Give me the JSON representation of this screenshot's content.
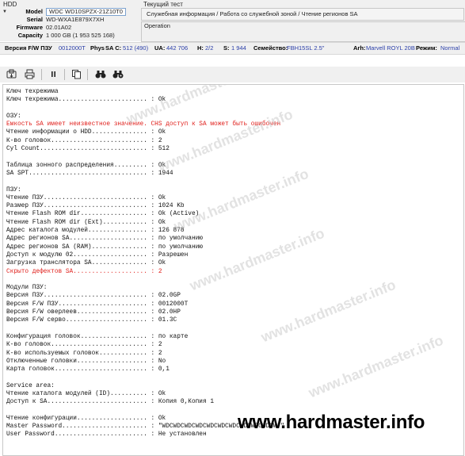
{
  "hdd": {
    "group_title": "HDD",
    "rows": [
      {
        "label": "Model",
        "value": "WDC WD10SPZX-21Z10T0"
      },
      {
        "label": "Serial",
        "value": "WD-WXA1E879X7XH"
      },
      {
        "label": "Firmware",
        "value": "02.01A02"
      },
      {
        "label": "Capacity",
        "value": "1 000 GB (1 953 525 168)"
      }
    ]
  },
  "test": {
    "group_title": "Текущий тест",
    "text": "Служебная информация / Работа со служебной зоной / Чтение регионов SA"
  },
  "operation": {
    "group_title": "Operation"
  },
  "status": {
    "fw_label": "Версия F/W ПЗУ",
    "fw_value": "0012000T",
    "phys_label": "Phys",
    "sac_label": "SA C:",
    "sac_value": "512 (490)",
    "ua_label": "UA:",
    "ua_value": "442 706",
    "h_label": "H:",
    "h_value": "2/2",
    "s_label": "S:",
    "s_value": "1 944",
    "family_label": "Семейство:",
    "family_value": "FBH15SL 2.5\"",
    "arch_label": "Arh:",
    "arch_value": "Marvell ROYL 20B",
    "mode_label": "Режим:",
    "mode_value": "Normal"
  },
  "toolbar": {
    "buttons": [
      {
        "icon": "save-log-icon"
      },
      {
        "icon": "print-icon"
      },
      {
        "icon": "pause-icon"
      },
      {
        "icon": "copy-icon"
      },
      {
        "icon": "find-icon"
      },
      {
        "icon": "find-next-icon"
      }
    ]
  },
  "log": {
    "lines": [
      {
        "text": "Ключ техрежима",
        "red": false
      },
      {
        "text": "Ключ техрежима........................ : Ok",
        "red": false
      },
      {
        "text": "",
        "red": false
      },
      {
        "text": "ОЗУ:",
        "red": false
      },
      {
        "text": "Емкость SA имеет неизвестное значение. CHS доступ к SA может быть ошибочен",
        "red": true
      },
      {
        "text": "Чтение информации о HDD............... : Ok",
        "red": false
      },
      {
        "text": "К-во головок.......................... : 2",
        "red": false
      },
      {
        "text": "Cyl Count............................. : 512",
        "red": false
      },
      {
        "text": "",
        "red": false
      },
      {
        "text": "Таблица зонного распределения......... : Ok",
        "red": false
      },
      {
        "text": "SA SPT................................ : 1944",
        "red": false
      },
      {
        "text": "",
        "red": false
      },
      {
        "text": "ПЗУ:",
        "red": false
      },
      {
        "text": "Чтение ПЗУ............................ : Ok",
        "red": false
      },
      {
        "text": "Размер ПЗУ............................ : 1024 Kb",
        "red": false
      },
      {
        "text": "Чтение Flash ROM dir.................. : Ok (Active)",
        "red": false
      },
      {
        "text": "Чтение Flash ROM dir (Ext)............ : Ok",
        "red": false
      },
      {
        "text": "Адрес каталога модулей................ : 126 878",
        "red": false
      },
      {
        "text": "Адрес регионов SA..................... : по умолчанию",
        "red": false
      },
      {
        "text": "Адрес регионов SA (RAM)............... : по умолчанию",
        "red": false
      },
      {
        "text": "Доступ к модулю 02.................... : Разрешен",
        "red": false
      },
      {
        "text": "Загрузка транслятора SA............... : Ok",
        "red": false
      },
      {
        "text": "Скрыто дефектов SA.................... : 2",
        "red": true
      },
      {
        "text": "",
        "red": false
      },
      {
        "text": "Модули ПЗУ:",
        "red": false
      },
      {
        "text": "Версия ПЗУ............................ : 02.0GP",
        "red": false
      },
      {
        "text": "Версия F/W ПЗУ........................ : 0012000T",
        "red": false
      },
      {
        "text": "Версия F/W оверлеев................... : 02.0HP",
        "red": false
      },
      {
        "text": "Версия F/W серво...................... : 01.3C",
        "red": false
      },
      {
        "text": "",
        "red": false
      },
      {
        "text": "Конфигурация головок.................. : по карте",
        "red": false
      },
      {
        "text": "К-во головок.......................... : 2",
        "red": false
      },
      {
        "text": "К-во используемых головок............. : 2",
        "red": false
      },
      {
        "text": "Отключенные головки................... : No",
        "red": false
      },
      {
        "text": "Карта головок......................... : 0,1",
        "red": false
      },
      {
        "text": "",
        "red": false
      },
      {
        "text": "Service area:",
        "red": false
      },
      {
        "text": "Чтение каталога модулей (ID).......... : Ok",
        "red": false
      },
      {
        "text": "Доступ к SA........................... : Копия 0,Копия 1",
        "red": false
      },
      {
        "text": "",
        "red": false
      },
      {
        "text": "Чтение конфигурации................... : Ok",
        "red": false
      },
      {
        "text": "Master Password....................... : \"WDCWDCWDCWDCWDCWDCWDCWDCWDCWDCW.\"",
        "red": false
      },
      {
        "text": "User Password......................... : Не установлен",
        "red": false
      }
    ]
  },
  "watermark": {
    "text": "www.hardmaster.info",
    "url_text": "www.hardmaster.info"
  }
}
